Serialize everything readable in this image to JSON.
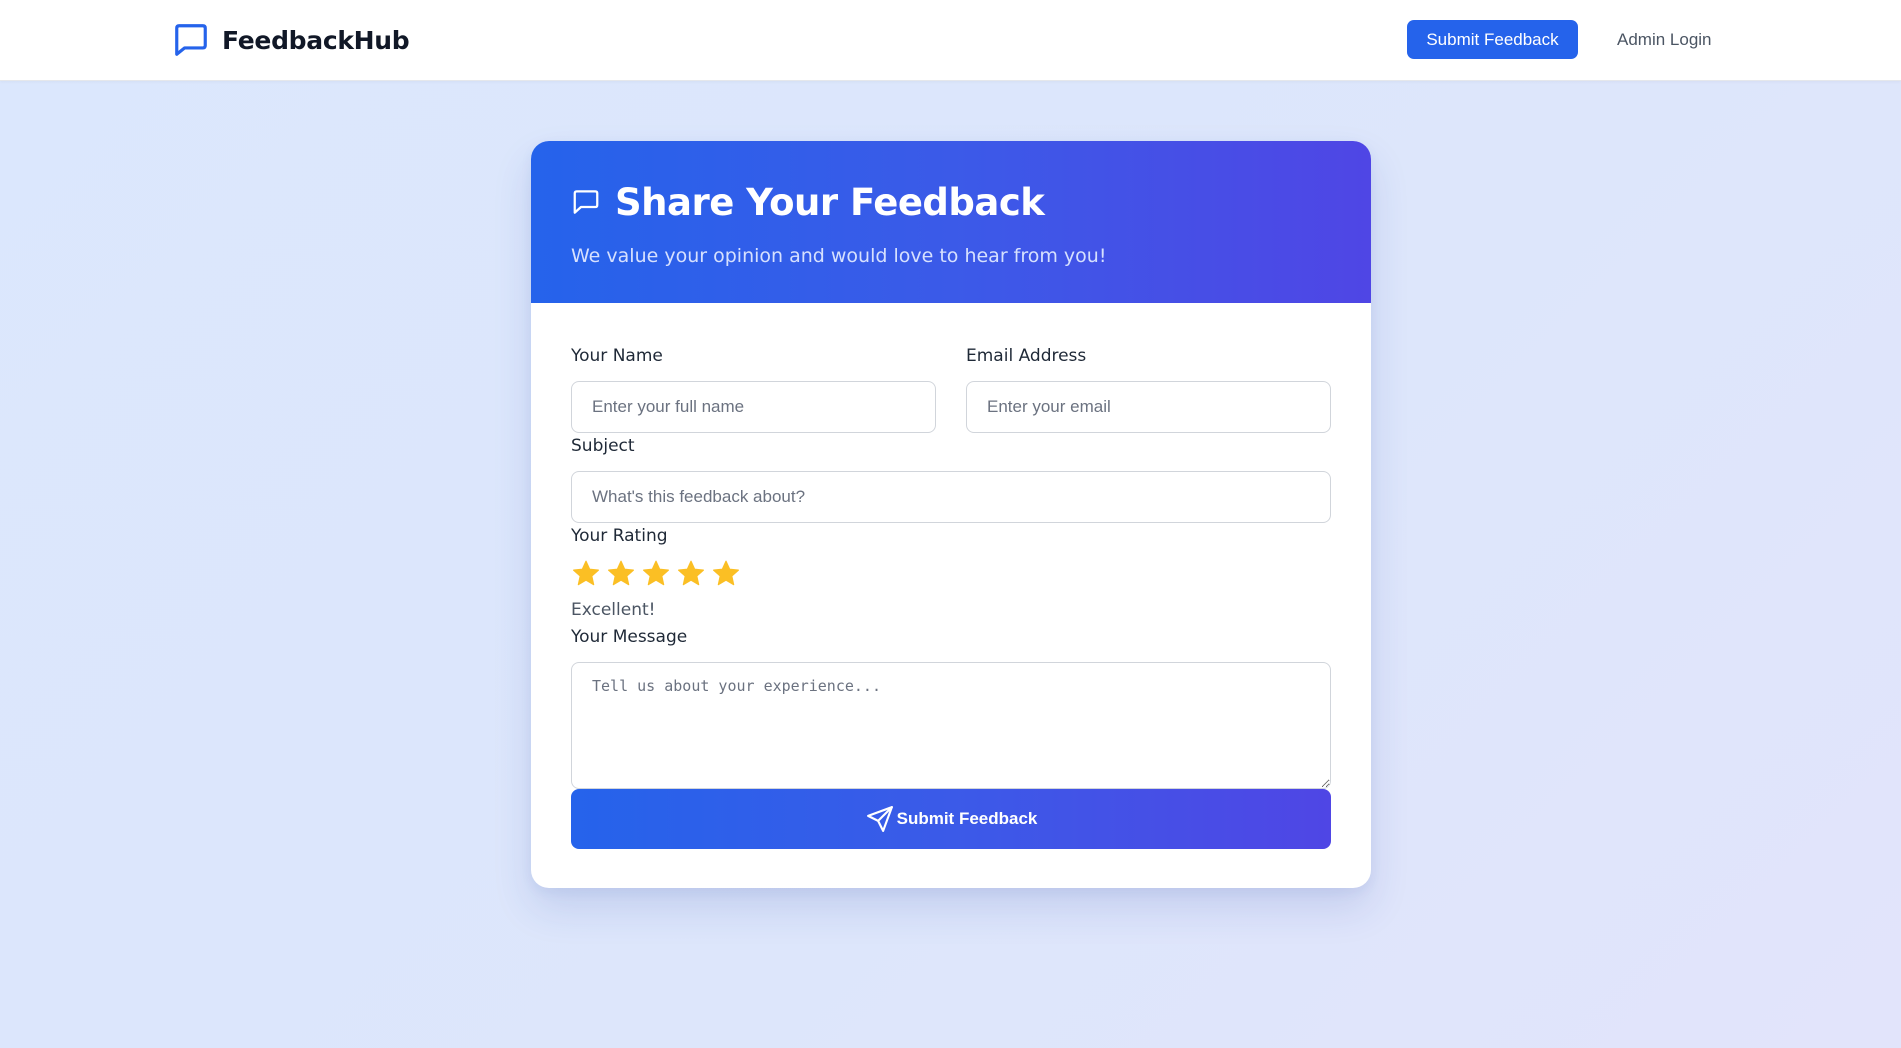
{
  "navbar": {
    "brand_icon": "chat-bubble-icon",
    "brand_name": "FeedbackHub",
    "submit_label": "Submit Feedback",
    "admin_label": "Admin Login"
  },
  "form": {
    "header_icon": "message-square-icon",
    "title": "Share Your Feedback",
    "subtitle": "We value your opinion and would love to hear from you!",
    "name": {
      "label": "Your Name",
      "placeholder": "Enter your full name",
      "value": ""
    },
    "email": {
      "label": "Email Address",
      "placeholder": "Enter your email",
      "value": ""
    },
    "subject": {
      "label": "Subject",
      "placeholder": "What's this feedback about?",
      "value": ""
    },
    "rating": {
      "label": "Your Rating",
      "value": 5,
      "max": 5,
      "text": "Excellent!"
    },
    "message": {
      "label": "Your Message",
      "placeholder": "Tell us about your experience...",
      "value": ""
    },
    "submit_icon": "send-icon",
    "submit_label": "Submit Feedback"
  },
  "colors": {
    "primary": "#2563eb",
    "gradient_end": "#4f46e5",
    "star": "#fbbf24",
    "page_bg": "#dbe7fd"
  }
}
